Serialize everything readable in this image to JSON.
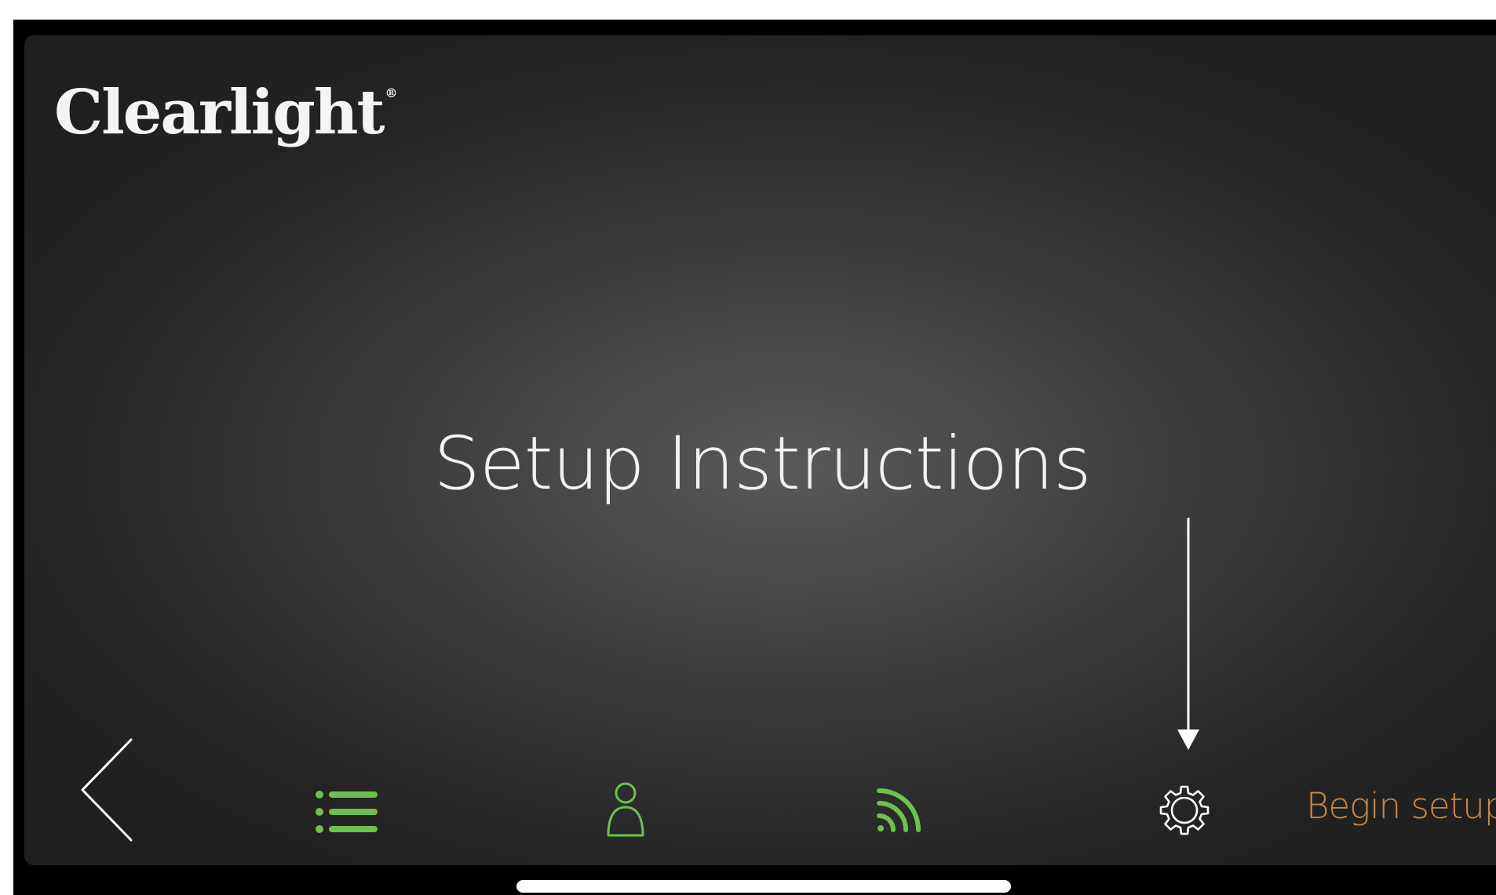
{
  "app": {
    "logo_text": "Clearlight",
    "logo_mark": "®"
  },
  "main": {
    "title": "Setup Instructions"
  },
  "nav": {
    "items": [
      {
        "icon": "chevron-left-icon",
        "color": "#ffffff"
      },
      {
        "icon": "list-icon",
        "color": "#6cc24a"
      },
      {
        "icon": "user-icon",
        "color": "#6cc24a"
      },
      {
        "icon": "wifi-icon",
        "color": "#6cc24a"
      },
      {
        "icon": "gear-icon",
        "color": "#ffffff"
      }
    ],
    "begin_setup_label": "Begin setup",
    "begin_setup_color": "#c88a45"
  },
  "annotation": {
    "arrow_icon": "down-arrow-icon",
    "arrow_color": "#ffffff"
  },
  "colors": {
    "accent_green": "#6cc24a",
    "accent_orange": "#c88a45",
    "background": "#2b2b2b"
  }
}
